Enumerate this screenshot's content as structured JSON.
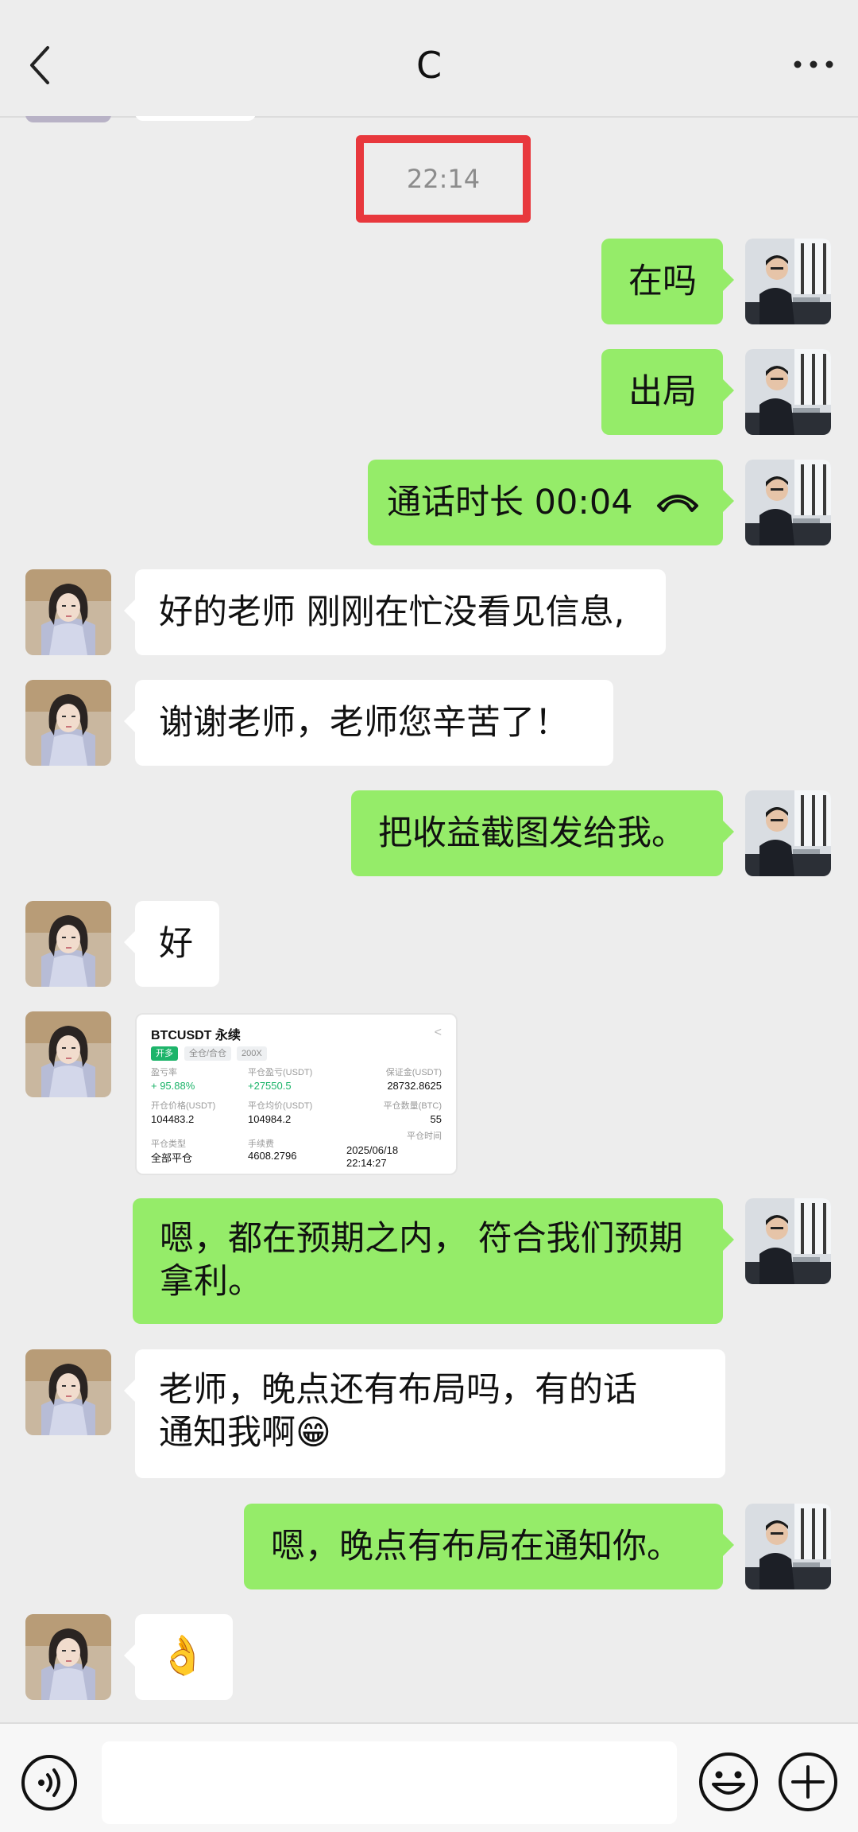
{
  "header": {
    "title": "C"
  },
  "timestamp": "22:14",
  "messages": [
    {
      "side": "right",
      "text": "在吗"
    },
    {
      "side": "right",
      "text": "出局"
    },
    {
      "side": "right",
      "text": "通话时长 00:04",
      "icon": "phone-hangup-icon"
    },
    {
      "side": "left",
      "text": "好的老师 刚刚在忙没看见信息,"
    },
    {
      "side": "left",
      "text": "谢谢老师，老师您辛苦了！"
    },
    {
      "side": "right",
      "text": "把收益截图发给我。"
    },
    {
      "side": "left",
      "text": "好"
    },
    {
      "side": "right",
      "text": "嗯，都在预期之内， 符合我们预期拿利。"
    },
    {
      "side": "left",
      "text": "老师，晚点还有布局吗，有的话通知我啊",
      "emoji": "😁"
    },
    {
      "side": "right",
      "text": "嗯，晚点有布局在通知你。"
    },
    {
      "side": "left",
      "text": "",
      "emoji": "👌"
    }
  ],
  "trade_card": {
    "title": "BTCUSDT 永续",
    "tag_open": "开多",
    "tag_mode": "全仓/合仓",
    "tag_leverage": "200X",
    "labels": {
      "pnl_rate": "盈亏率",
      "pnl": "平仓盈亏(USDT)",
      "margin": "保证金(USDT)",
      "open_price": "开仓价格(USDT)",
      "close_price": "平仓均价(USDT)",
      "close_qty": "平仓数量(BTC)",
      "close_type": "平仓类型",
      "fee": "手续费",
      "close_time": "平仓时间"
    },
    "values": {
      "pnl_rate": "+ 95.88%",
      "pnl": "+27550.5",
      "margin": "28732.8625",
      "open_price": "104483.2",
      "close_price": "104984.2",
      "close_qty": "55",
      "close_type": "全部平仓",
      "fee": "4608.2796",
      "close_date": "2025/06/18",
      "close_clock": "22:14:27"
    }
  },
  "colors": {
    "bubble_out": "#95ec69",
    "bubble_in": "#ffffff",
    "background": "#ededed",
    "highlight_box": "#e8383d"
  },
  "icons": [
    "back-icon",
    "more-icon",
    "voice-icon",
    "emoji-icon",
    "plus-icon"
  ]
}
